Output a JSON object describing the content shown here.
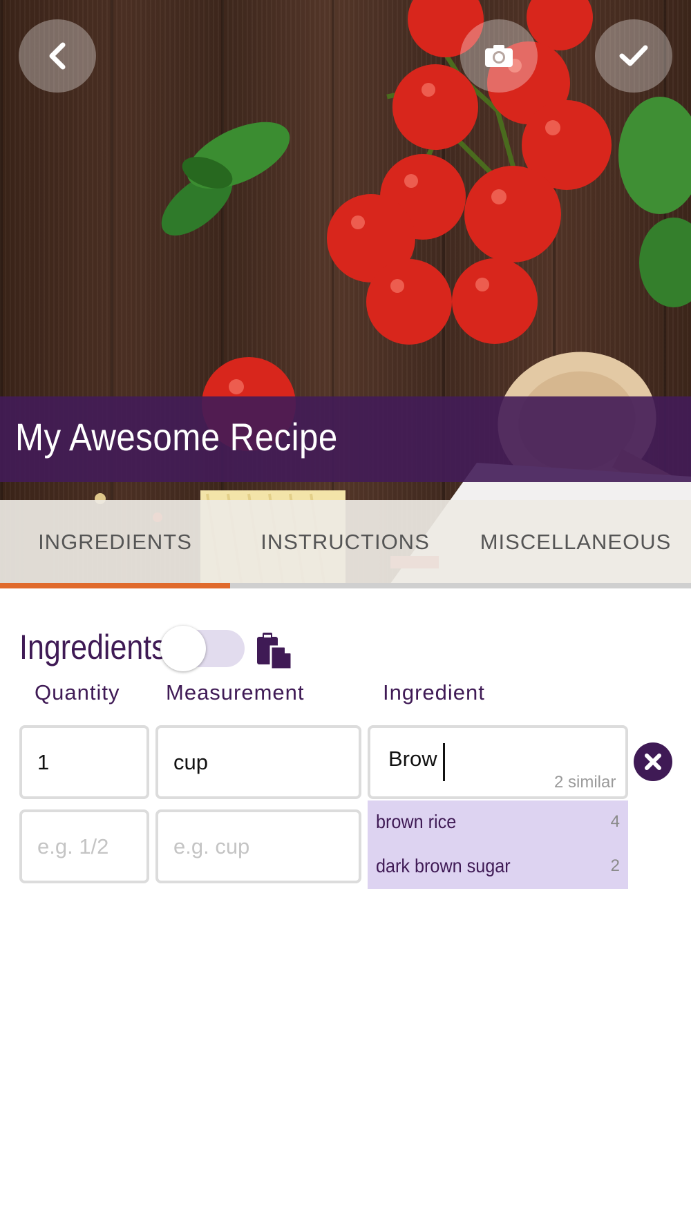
{
  "header": {
    "title": "My Awesome Recipe",
    "back_icon": "chevron-left-icon",
    "camera_icon": "camera-icon",
    "confirm_icon": "checkmark-icon"
  },
  "tabs": [
    {
      "label": "INGREDIENTS",
      "active": true
    },
    {
      "label": "INSTRUCTIONS",
      "active": false
    },
    {
      "label": "MISCELLANEOUS",
      "active": false
    }
  ],
  "ingredients_section": {
    "title": "Ingredients",
    "toggle_on": false,
    "paste_icon": "paste-icon",
    "columns": {
      "quantity": "Quantity",
      "measurement": "Measurement",
      "ingredient": "Ingredient"
    },
    "rows": [
      {
        "quantity": "1",
        "measurement": "cup",
        "ingredient": "Brow",
        "similar": "2 similar",
        "remove_icon": "remove-icon"
      },
      {
        "quantity_placeholder": "e.g. 1/2",
        "measurement_placeholder": "e.g. cup"
      }
    ],
    "suggestions": [
      {
        "name": "brown rice",
        "count": "4"
      },
      {
        "name": "dark brown sugar",
        "count": "2"
      }
    ]
  },
  "colors": {
    "brand_purple": "#3f1a55",
    "accent_orange": "#e06a2c",
    "suggestion_bg": "#ddd3f1"
  }
}
